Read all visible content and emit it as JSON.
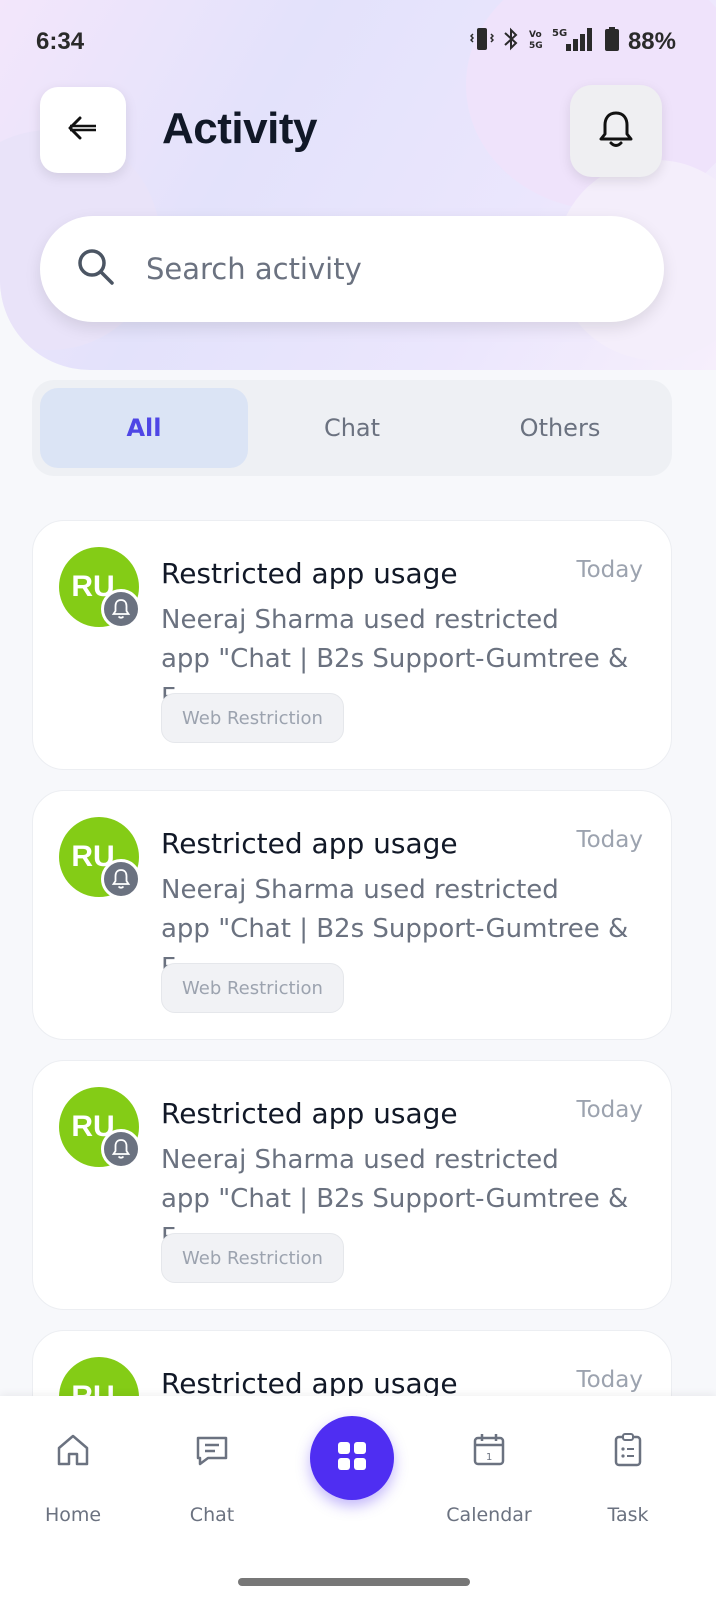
{
  "status_bar": {
    "time": "6:34",
    "battery": "88%"
  },
  "header": {
    "title": "Activity"
  },
  "search": {
    "placeholder": "Search activity"
  },
  "tabs": [
    {
      "label": "All",
      "active": true
    },
    {
      "label": "Chat",
      "active": false
    },
    {
      "label": "Others",
      "active": false
    }
  ],
  "activities": [
    {
      "initials": "RU",
      "title": "Restricted app usage",
      "time": "Today",
      "description": "Neeraj Sharma used restricted\napp \"Chat | B2s Support-Gumtree & F...",
      "tag": "Web Restriction"
    },
    {
      "initials": "RU",
      "title": "Restricted app usage",
      "time": "Today",
      "description": "Neeraj Sharma used restricted\napp \"Chat | B2s Support-Gumtree & F...",
      "tag": "Web Restriction"
    },
    {
      "initials": "RU",
      "title": "Restricted app usage",
      "time": "Today",
      "description": "Neeraj Sharma used restricted\napp \"Chat | B2s Support-Gumtree & F...",
      "tag": "Web Restriction"
    },
    {
      "initials": "RU",
      "title": "Restricted app usage",
      "time": "Today",
      "description": "",
      "tag": ""
    }
  ],
  "bottom_nav": {
    "items": [
      {
        "label": "Home",
        "icon": "home-icon"
      },
      {
        "label": "Chat",
        "icon": "chat-icon"
      },
      {
        "label": "Calendar",
        "icon": "calendar-icon"
      },
      {
        "label": "Task",
        "icon": "task-icon"
      }
    ],
    "center_icon": "grid-icon"
  },
  "colors": {
    "accent": "#4f2ef2",
    "tab_active_text": "#4f46e5",
    "avatar": "#84cc16"
  }
}
